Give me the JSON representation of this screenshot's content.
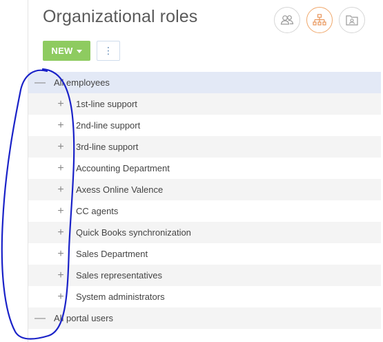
{
  "page": {
    "title": "Organizational roles"
  },
  "view_buttons": [
    {
      "icon": "users-icon",
      "active": false
    },
    {
      "icon": "org-structure-icon",
      "active": true
    },
    {
      "icon": "contact-card-icon",
      "active": false
    }
  ],
  "toolbar": {
    "new_label": "NEW",
    "more_label": "⋮"
  },
  "tree": {
    "expanded_symbol": "—",
    "collapsed_symbol": "+",
    "root": {
      "label": "All employees"
    },
    "children": [
      {
        "label": "1st-line support"
      },
      {
        "label": "2nd-line support"
      },
      {
        "label": "3rd-line support"
      },
      {
        "label": "Accounting Department"
      },
      {
        "label": "Axess Online Valence"
      },
      {
        "label": "CC agents"
      },
      {
        "label": "Quick Books synchronization"
      },
      {
        "label": "Sales Department"
      },
      {
        "label": "Sales representatives"
      },
      {
        "label": "System administrators"
      }
    ],
    "root2": {
      "label": "All portal users"
    }
  },
  "colors": {
    "new_button": "#8ecb60",
    "accent_active": "#f0a86c",
    "selected_row": "#e3e9f6",
    "annotation_stroke": "#1a22c8"
  }
}
